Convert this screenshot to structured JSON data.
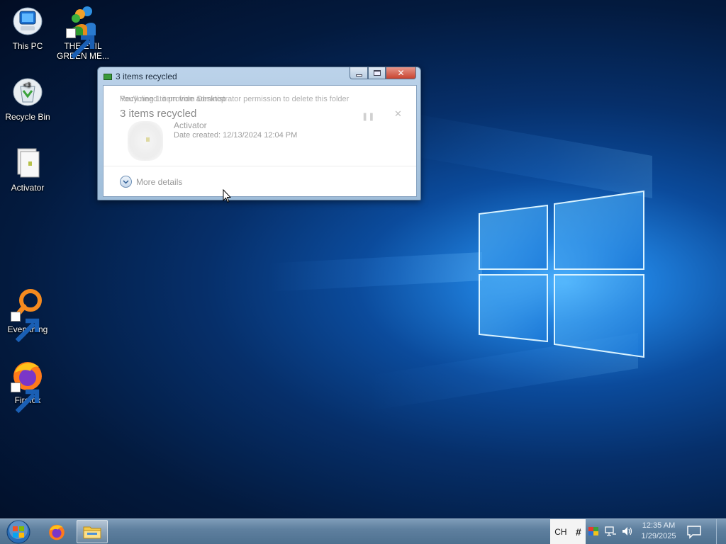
{
  "desktop": {
    "icons": [
      {
        "label": "This PC",
        "icon": "computer-icon"
      },
      {
        "label": "THE EVIL GREEN ME...",
        "icon": "messenger-people-icon"
      },
      {
        "label": "Recycle Bin",
        "icon": "recycle-bin-icon"
      },
      {
        "label": "Activator",
        "icon": "file-icon"
      },
      {
        "label": "Everything",
        "icon": "search-magnifier-icon"
      },
      {
        "label": "Firefox",
        "icon": "firefox-icon"
      }
    ]
  },
  "dialog": {
    "title": "3 items recycled",
    "overlay_text": "Recycling 1 item from Desktop",
    "ghost_text": "You'll need to provide administrator permission to delete this folder",
    "headline": "3 items recycled",
    "item_name": "Activator",
    "item_date": "Date created: 12/13/2024 12:04 PM",
    "more_details": "More details"
  },
  "taskbar": {
    "language": "CH",
    "clock_time": "12:35 AM",
    "clock_date": "1/29/2025",
    "buttons": [
      "start-button",
      "firefox-taskbar",
      "file-explorer-taskbar"
    ]
  },
  "colors": {
    "accent": "#1f7fdc",
    "taskbar": "#5f809f"
  }
}
